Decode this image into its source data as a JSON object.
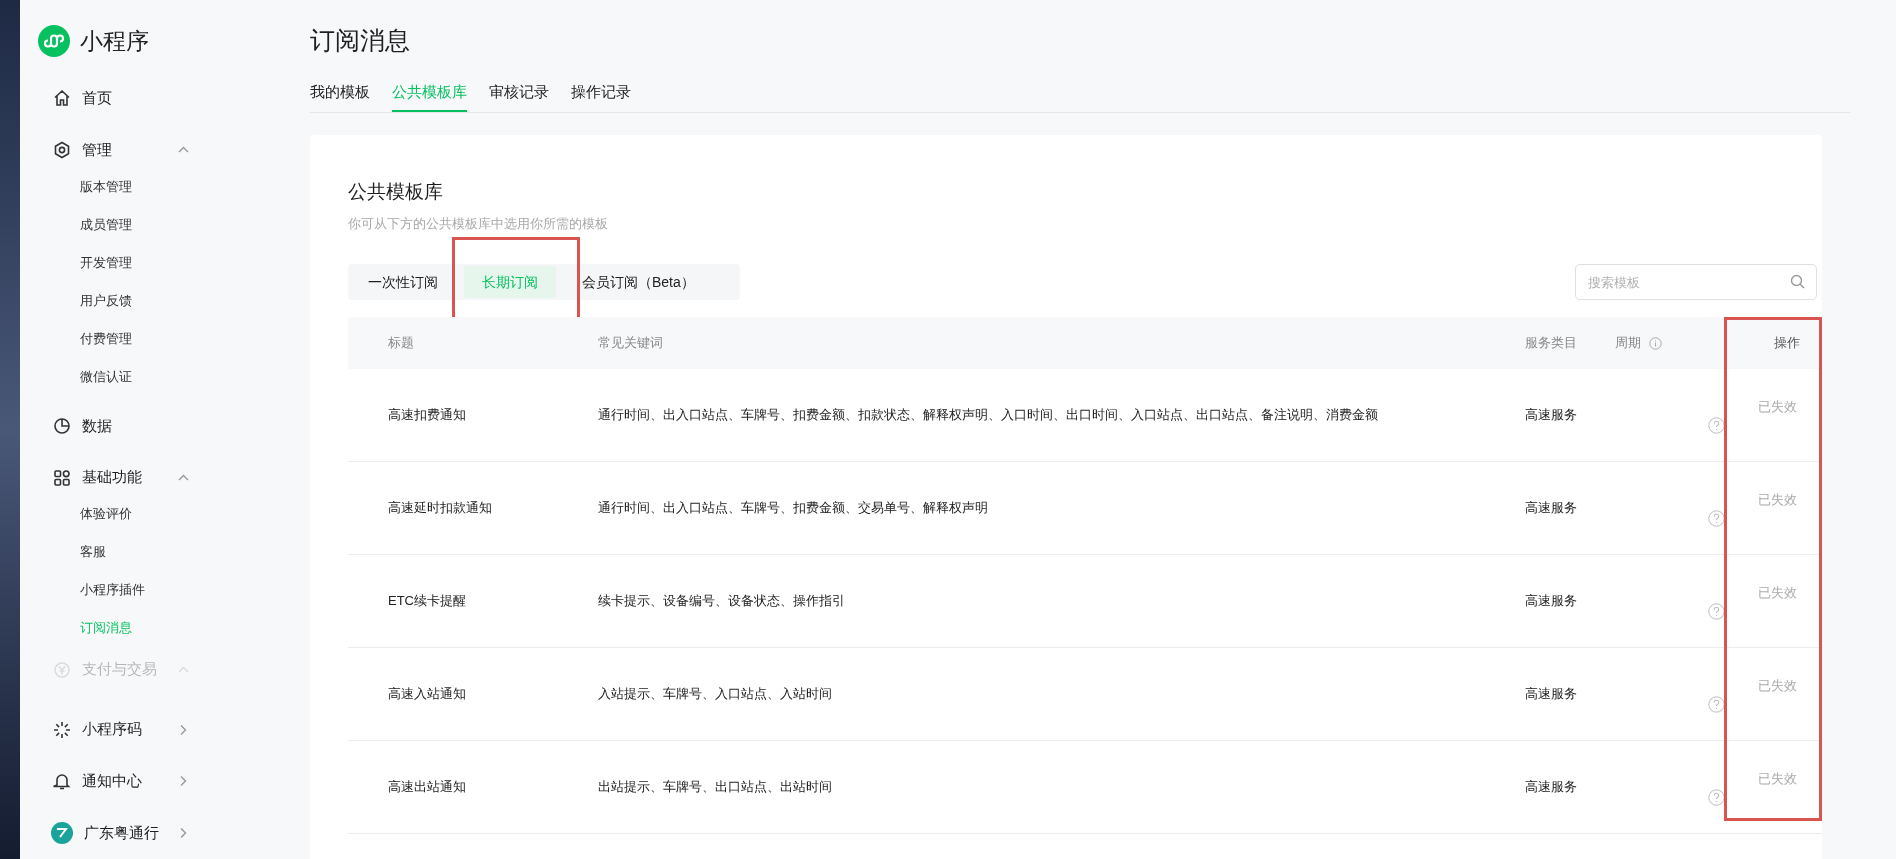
{
  "app": {
    "title": "小程序"
  },
  "sidebar": {
    "items": [
      {
        "label": "首页",
        "kind": "plain"
      },
      {
        "label": "管理",
        "kind": "collapsible",
        "expanded": true,
        "children": [
          {
            "label": "版本管理",
            "selected": false
          },
          {
            "label": "成员管理",
            "selected": false
          },
          {
            "label": "开发管理",
            "selected": false
          },
          {
            "label": "用户反馈",
            "selected": false
          },
          {
            "label": "付费管理",
            "selected": false
          },
          {
            "label": "微信认证",
            "selected": false
          }
        ]
      },
      {
        "label": "数据",
        "kind": "plain"
      },
      {
        "label": "基础功能",
        "kind": "collapsible",
        "expanded": true,
        "children": [
          {
            "label": "体验评价",
            "selected": false
          },
          {
            "label": "客服",
            "selected": false
          },
          {
            "label": "小程序插件",
            "selected": false
          },
          {
            "label": "订阅消息",
            "selected": true
          }
        ]
      },
      {
        "label": "支付与交易",
        "kind": "faded"
      },
      {
        "label": "小程序码",
        "kind": "link"
      },
      {
        "label": "通知中心",
        "kind": "link"
      },
      {
        "label": "广东粤通行",
        "kind": "account"
      }
    ]
  },
  "page": {
    "title": "订阅消息"
  },
  "tabs": [
    {
      "label": "我的模板",
      "selected": false
    },
    {
      "label": "公共模板库",
      "selected": true
    },
    {
      "label": "审核记录",
      "selected": false
    },
    {
      "label": "操作记录",
      "selected": false
    }
  ],
  "card": {
    "title": "公共模板库",
    "subtitle": "你可从下方的公共模板库中选用你所需的模板",
    "segments": [
      {
        "label": "一次性订阅",
        "selected": false,
        "highlighted": false
      },
      {
        "label": "长期订阅",
        "selected": true,
        "highlighted": true
      },
      {
        "label": "会员订阅（Beta）",
        "selected": false,
        "highlighted": false
      }
    ],
    "search": {
      "placeholder": "搜索模板"
    },
    "table": {
      "columns": [
        {
          "label": "标题",
          "highlighted": false
        },
        {
          "label": "常见关键词",
          "highlighted": false
        },
        {
          "label": "服务类目",
          "highlighted": false
        },
        {
          "label": "周期",
          "highlighted": false
        },
        {
          "label": "操作",
          "highlighted": true
        }
      ],
      "rows": [
        {
          "title": "高速扣费通知",
          "keywords": "通行时间、出入口站点、车牌号、扣费金额、扣款状态、解释权声明、入口时间、出口时间、入口站点、出口站点、备注说明、消费金额",
          "category": "高速服务",
          "action": "已失效"
        },
        {
          "title": "高速延时扣款通知",
          "keywords": "通行时间、出入口站点、车牌号、扣费金额、交易单号、解释权声明",
          "category": "高速服务",
          "action": "已失效"
        },
        {
          "title": "ETC续卡提醒",
          "keywords": "续卡提示、设备编号、设备状态、操作指引",
          "category": "高速服务",
          "action": "已失效"
        },
        {
          "title": "高速入站通知",
          "keywords": "入站提示、车牌号、入口站点、入站时间",
          "category": "高速服务",
          "action": "已失效"
        },
        {
          "title": "高速出站通知",
          "keywords": "出站提示、车牌号、出口站点、出站时间",
          "category": "高速服务",
          "action": "已失效"
        }
      ]
    }
  }
}
